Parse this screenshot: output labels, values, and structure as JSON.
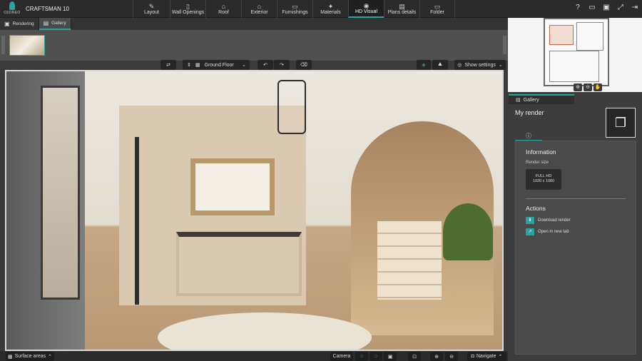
{
  "app": {
    "logo_text": "CEDREO",
    "project_name": "CRAFTSMAN 10"
  },
  "nav": [
    {
      "label": "Layout",
      "icon": "pencil-icon",
      "glyph": "✎"
    },
    {
      "label": "Wall Openings",
      "icon": "door-icon",
      "glyph": "▯"
    },
    {
      "label": "Roof",
      "icon": "roof-icon",
      "glyph": "⌂"
    },
    {
      "label": "Exterior",
      "icon": "house-icon",
      "glyph": "⌂"
    },
    {
      "label": "Furnishings",
      "icon": "sofa-icon",
      "glyph": "▭"
    },
    {
      "label": "Materials",
      "icon": "paint-roller-icon",
      "glyph": "✦"
    },
    {
      "label": "HD Visual",
      "icon": "camera-icon",
      "glyph": "◉"
    },
    {
      "label": "Plans details",
      "icon": "plan-icon",
      "glyph": "▤"
    },
    {
      "label": "Folder",
      "icon": "folder-icon",
      "glyph": "▭"
    }
  ],
  "right_icons": [
    {
      "name": "help-icon",
      "glyph": "?"
    },
    {
      "name": "comment-icon",
      "glyph": "▭"
    },
    {
      "name": "save-icon",
      "glyph": "▣"
    },
    {
      "name": "fullscreen-icon",
      "glyph": "⤢"
    },
    {
      "name": "logout-icon",
      "glyph": "⇥"
    }
  ],
  "subtabs": [
    {
      "label": "Rendering",
      "icon": "image-icon",
      "glyph": "▣"
    },
    {
      "label": "Gallery",
      "icon": "gallery-icon",
      "glyph": "▤"
    }
  ],
  "toolbar": {
    "swap_glyph": "⇄",
    "floor_label": "Ground Floor",
    "undo_glyph": "↶",
    "redo_glyph": "↷",
    "show_settings": "Show settings"
  },
  "bottom": {
    "surface_areas": "Surface areas",
    "camera": "Camera",
    "navigate": "Navigate"
  },
  "side": {
    "tab_label": "Gallery",
    "title": "My render",
    "info_heading": "Information",
    "render_size_label": "Render size",
    "render_size_value_1": "FULL HD",
    "render_size_value_2": "1920 x 1080",
    "actions_heading": "Actions",
    "actions": [
      "Download render",
      "Open in new tab"
    ]
  },
  "colors": {
    "accent": "#2aa3a3",
    "bar": "#2b2b2b",
    "panel": "#3d3d3d"
  }
}
